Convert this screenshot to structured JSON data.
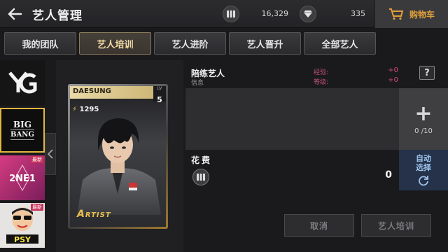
{
  "header": {
    "title": "艺人管理",
    "currency_a_value": "16,329",
    "currency_b_value": "335",
    "cart_label": "购物车"
  },
  "tabs": [
    {
      "label": "我的团队",
      "active": false
    },
    {
      "label": "艺人培训",
      "active": true
    },
    {
      "label": "艺人进阶",
      "active": false
    },
    {
      "label": "艺人晋升",
      "active": false
    },
    {
      "label": "全部艺人",
      "active": false
    }
  ],
  "groups": [
    {
      "name": "YG",
      "logo_text": "YG",
      "new": false
    },
    {
      "name": "BIGBANG",
      "logo_text_line1": "BIG",
      "logo_text_line2": "BANG",
      "new": false,
      "selected": true
    },
    {
      "name": "2NE1",
      "logo_text": "2NE1",
      "new": true,
      "badge": "最新"
    },
    {
      "name": "PSY",
      "logo_text": "PSY",
      "new": true,
      "badge": "最新"
    }
  ],
  "card": {
    "name": "DAESUNG",
    "level_tag": "LV",
    "level": "5",
    "power": "1295",
    "rank_text": "RTIST"
  },
  "trainer": {
    "title": "陪练艺人",
    "subtitle": "信息",
    "exp_label": "经验:",
    "exp_value": "+0",
    "level_label": "等级:",
    "level_value": "+0",
    "help_label": "?"
  },
  "slots": {
    "add_symbol": "+",
    "count": "0 /10"
  },
  "cost": {
    "label": "花费",
    "value": "0"
  },
  "auto_select_label": "自动选择",
  "buttons": {
    "cancel": "取消",
    "train": "艺人培训"
  },
  "colors": {
    "accent_gold": "#e0a03a",
    "stat_pink": "#d64a7a",
    "auto_blue": "#9ec4ee"
  }
}
